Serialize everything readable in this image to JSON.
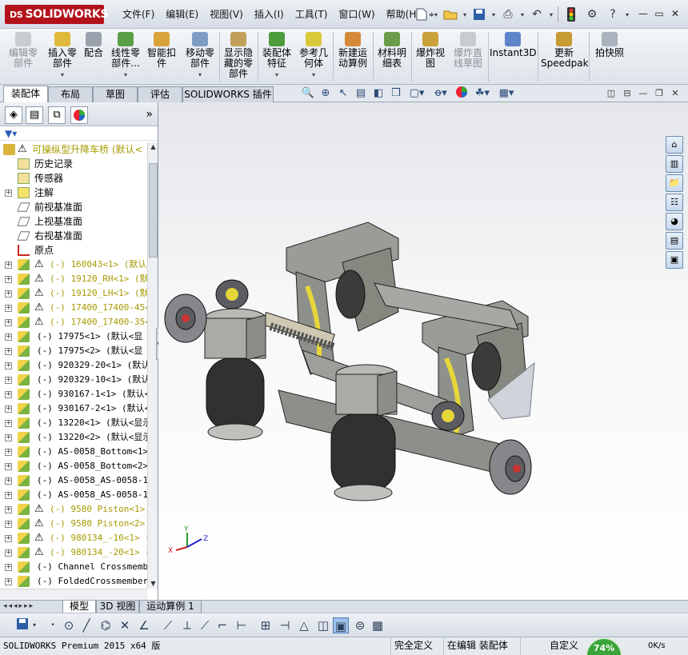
{
  "app": {
    "logo_text": "SOLIDWORKS",
    "logo_mark": "DS"
  },
  "menu": [
    "文件(F)",
    "编辑(E)",
    "视图(V)",
    "插入(I)",
    "工具(T)",
    "窗口(W)",
    "帮助(H)"
  ],
  "window_controls": {
    "minimize": "—",
    "restore": "▭",
    "close": "✕"
  },
  "commands": [
    {
      "label": "编辑零\n部件",
      "disabled": true,
      "icon": "edit-component-icon"
    },
    {
      "label": "插入零\n部件",
      "disabled": false,
      "icon": "insert-component-icon"
    },
    {
      "label": "配合",
      "disabled": false,
      "icon": "mate-icon"
    },
    {
      "label": "线性零\n部件...",
      "disabled": false,
      "icon": "linear-pattern-icon"
    },
    {
      "label": "智能扣\n件",
      "disabled": false,
      "icon": "smart-fasteners-icon"
    },
    {
      "label": "移动零\n部件",
      "disabled": false,
      "icon": "move-component-icon"
    },
    {
      "label": "显示隐\n藏的零\n部件",
      "disabled": false,
      "icon": "show-hidden-icon"
    },
    {
      "label": "装配体\n特征",
      "disabled": false,
      "icon": "assembly-feature-icon"
    },
    {
      "label": "参考几\n何体",
      "disabled": false,
      "icon": "reference-geometry-icon"
    },
    {
      "label": "新建运\n动算例",
      "disabled": false,
      "icon": "new-motion-study-icon"
    },
    {
      "label": "材料明\n细表",
      "disabled": false,
      "icon": "bom-icon"
    },
    {
      "label": "爆炸视\n图",
      "disabled": false,
      "icon": "exploded-view-icon"
    },
    {
      "label": "爆炸直\n线草图",
      "disabled": true,
      "icon": "explode-line-icon"
    },
    {
      "label": "Instant3D",
      "disabled": false,
      "icon": "instant3d-icon"
    },
    {
      "label": "更新\nSpeedpak",
      "disabled": false,
      "icon": "speedpak-icon"
    },
    {
      "label": "拍快照",
      "disabled": false,
      "icon": "snapshot-icon"
    }
  ],
  "tabs": [
    "装配体",
    "布局",
    "草图",
    "评估",
    "SOLIDWORKS 插件"
  ],
  "active_tab": "装配体",
  "tree": {
    "root": "可操纵型升降车桥  (默认<",
    "items": [
      {
        "label": "历史记录",
        "kind": "folder"
      },
      {
        "label": "传感器",
        "kind": "folder"
      },
      {
        "label": "注解",
        "kind": "annot",
        "expand": true
      },
      {
        "label": "前视基准面",
        "kind": "plane"
      },
      {
        "label": "上视基准面",
        "kind": "plane"
      },
      {
        "label": "右视基准面",
        "kind": "plane"
      },
      {
        "label": "原点",
        "kind": "origin"
      },
      {
        "label": "(-) 160043<1> (默认<",
        "kind": "part",
        "warn": true
      },
      {
        "label": "(-) 19120_RH<1> (默认",
        "kind": "part",
        "warn": true
      },
      {
        "label": "(-) 19120_LH<1> (默认",
        "kind": "part",
        "warn": true
      },
      {
        "label": "(-) 17400_17400-45<1",
        "kind": "part",
        "warn": true
      },
      {
        "label": "(-) 17400_17400-35<1",
        "kind": "part",
        "warn": true
      },
      {
        "label": "(-) 17975<1> (默认<显",
        "kind": "part",
        "warn": false
      },
      {
        "label": "(-) 17975<2> (默认<显",
        "kind": "part",
        "warn": false
      },
      {
        "label": "(-) 920329-20<1> (默认<",
        "kind": "part",
        "warn": false
      },
      {
        "label": "(-) 920329-10<1> (默认<",
        "kind": "part",
        "warn": false
      },
      {
        "label": "(-) 930167-1<1> (默认<显",
        "kind": "part",
        "warn": false
      },
      {
        "label": "(-) 930167-2<1> (默认<显",
        "kind": "part",
        "warn": false
      },
      {
        "label": "(-) 13220<1> (默认<显示",
        "kind": "part",
        "warn": false
      },
      {
        "label": "(-) 13220<2> (默认<显示",
        "kind": "part",
        "warn": false
      },
      {
        "label": "(-) AS-0058_Bottom<1> (",
        "kind": "part",
        "warn": false
      },
      {
        "label": "(-) AS-0058_Bottom<2> (",
        "kind": "part",
        "warn": false
      },
      {
        "label": "(-) AS-0058_AS-0058-1F",
        "kind": "part",
        "warn": false
      },
      {
        "label": "(-) AS-0058_AS-0058-1F",
        "kind": "part",
        "warn": false
      },
      {
        "label": "(-) 9580 Piston<1> (",
        "kind": "part",
        "warn": true
      },
      {
        "label": "(-) 9580 Piston<2> (",
        "kind": "part",
        "warn": true
      },
      {
        "label": "(-) 980134_-10<1> (默",
        "kind": "part",
        "warn": true
      },
      {
        "label": "(-) 980134_-20<1> (默",
        "kind": "part",
        "warn": true
      },
      {
        "label": "(-) Channel Crossmember",
        "kind": "part",
        "warn": false
      },
      {
        "label": "(-) FoldedCrossmembers1",
        "kind": "part",
        "warn": false
      }
    ]
  },
  "bottom_tabs": [
    "模型",
    "3D 视图",
    "运动算例 1"
  ],
  "status": {
    "app": "SOLIDWORKS Premium 2015 x64 版",
    "definition": "完全定义",
    "editing": "在编辑 装配体",
    "custom": "自定义",
    "progress": "74%",
    "speed": "0K/s"
  },
  "colors": {
    "accent": "#b3121b",
    "warning": "#e8b400",
    "yellow_text": "#a79a00"
  }
}
